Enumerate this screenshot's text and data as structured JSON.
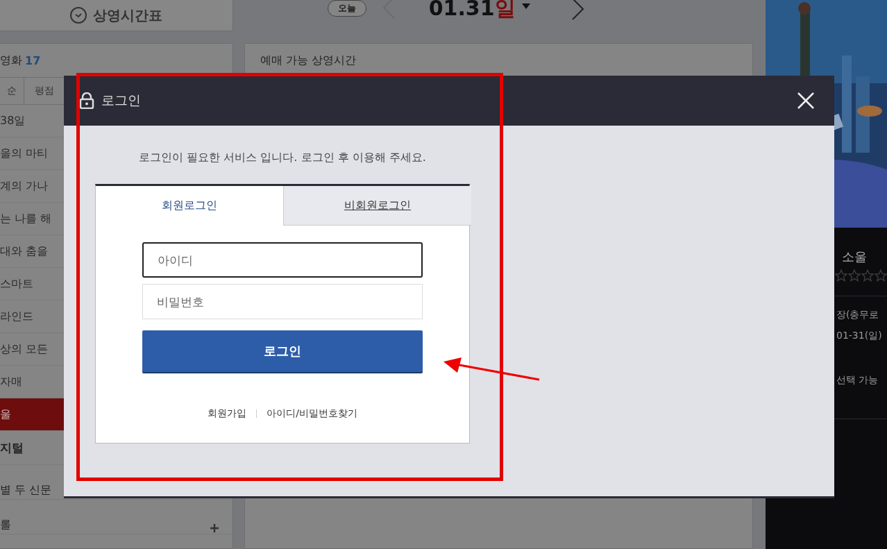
{
  "page": {
    "schedule_button": "상영시간표",
    "today_button": "오늘",
    "date": "01.31",
    "weekday": "일"
  },
  "movie_panel": {
    "title": "영화",
    "count": "17",
    "sort_tabs": [
      {
        "label": "순"
      },
      {
        "label": "평점"
      }
    ],
    "movies": [
      {
        "title": "38일",
        "selected": false
      },
      {
        "title": "을의 마티",
        "selected": false
      },
      {
        "title": "계의 가나",
        "selected": false
      },
      {
        "title": "는 나를 해",
        "selected": false
      },
      {
        "title": "대와 춤을",
        "selected": false
      },
      {
        "title": "스마트",
        "selected": false
      },
      {
        "title": "라인드",
        "selected": false
      },
      {
        "title": "상의 모든",
        "selected": false
      },
      {
        "title": "자매",
        "selected": false
      },
      {
        "title": "울",
        "selected": true
      }
    ],
    "format": "지털",
    "format_items": [
      {
        "title": "별 두 신문"
      },
      {
        "title": "롤"
      }
    ]
  },
  "showtimes_panel": {
    "title": "예매 가능 상영시간"
  },
  "summary": {
    "title": "소울",
    "stars": 0,
    "theater": "장(충무로",
    "date": "01-31(일)",
    "note": "선택 가능"
  },
  "login_dialog": {
    "title": "로그인",
    "message": "로그인이 필요한 서비스 입니다. 로그인 후 이용해 주세요.",
    "tabs": [
      {
        "label": "회원로그인",
        "selected": true
      },
      {
        "label": "비회원로그인",
        "selected": false
      }
    ],
    "id_field": {
      "placeholder": "아이디",
      "focused": true
    },
    "password_field": {
      "placeholder": "비밀번호",
      "focused": false
    },
    "login_button": "로그인",
    "links": [
      "회원가입",
      "아이디/비밀번호찾기"
    ]
  }
}
